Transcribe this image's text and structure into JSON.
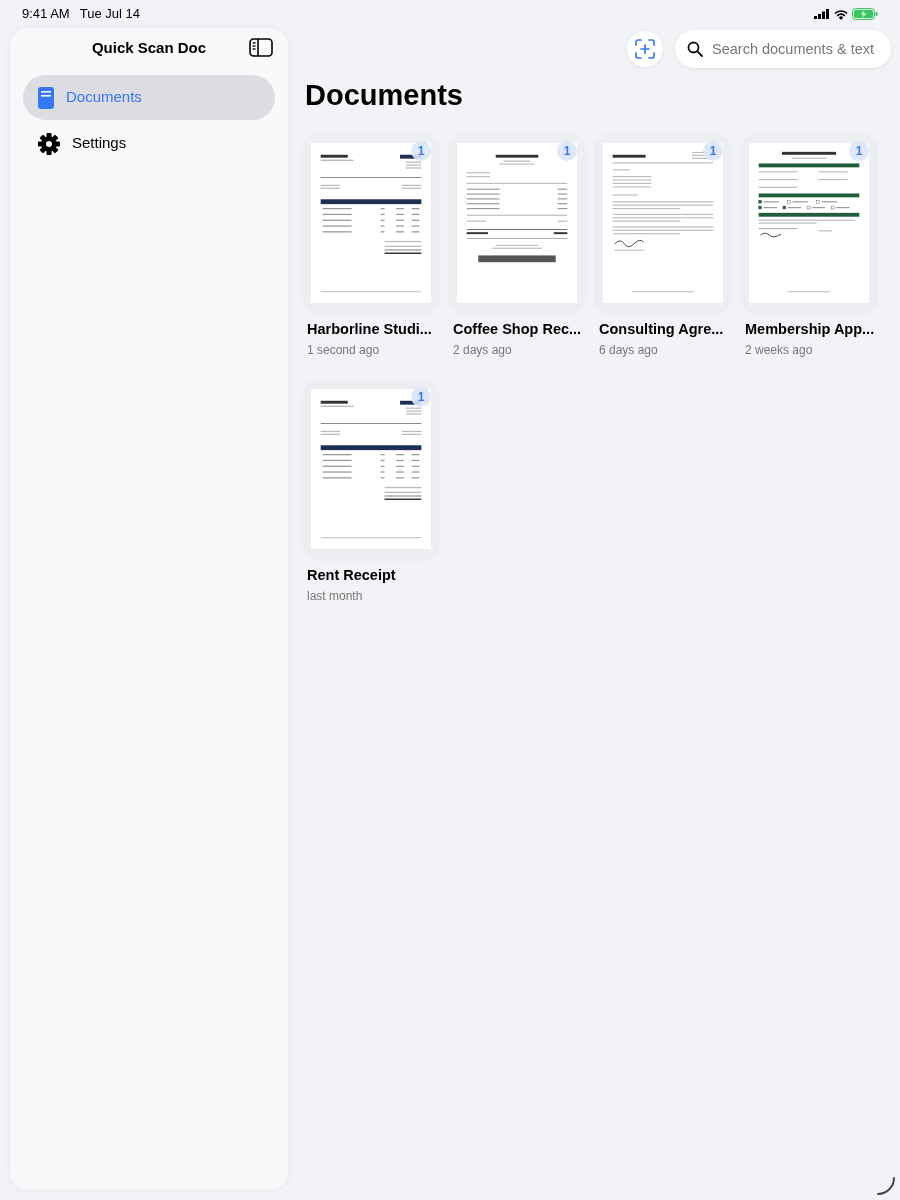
{
  "status_bar": {
    "time": "9:41 AM",
    "date": "Tue Jul 14"
  },
  "sidebar": {
    "title": "Quick Scan Doc",
    "items": [
      {
        "label": "Documents",
        "kind": "document",
        "selected": true
      },
      {
        "label": "Settings",
        "kind": "gear",
        "selected": false
      }
    ]
  },
  "toolbar": {
    "search": {
      "placeholder": "Search documents & text"
    }
  },
  "main": {
    "title": "Documents",
    "documents": [
      {
        "name": "Harborline Studi...",
        "modified": "1 second ago",
        "pages": "1",
        "kind": "invoice"
      },
      {
        "name": "Coffee Shop Rec...",
        "modified": "2 days ago",
        "pages": "1",
        "kind": "receipt"
      },
      {
        "name": "Consulting Agre...",
        "modified": "6 days ago",
        "pages": "1",
        "kind": "letter"
      },
      {
        "name": "Membership App...",
        "modified": "2 weeks ago",
        "pages": "1",
        "kind": "form"
      },
      {
        "name": "Rent Receipt",
        "modified": "last month",
        "pages": "1",
        "kind": "invoice"
      }
    ]
  }
}
